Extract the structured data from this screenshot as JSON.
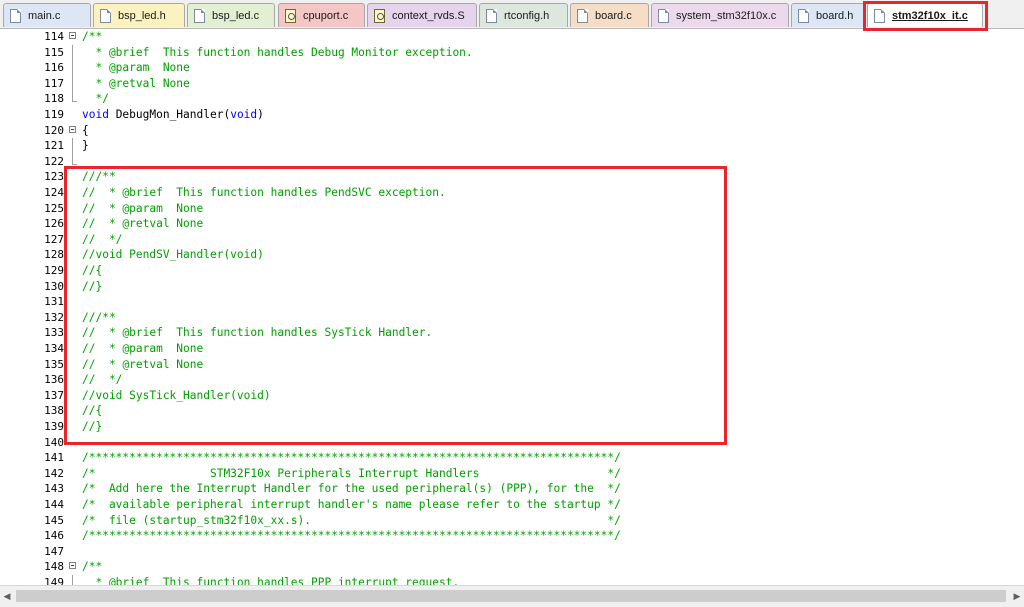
{
  "tabs": [
    {
      "label": "main.c",
      "color": "#dce6f4",
      "icon": "c-file-icon",
      "active": false
    },
    {
      "label": "bsp_led.h",
      "color": "#fbf2bf",
      "icon": "h-file-icon",
      "active": false
    },
    {
      "label": "bsp_led.c",
      "color": "#e3efd3",
      "icon": "c-file-icon",
      "active": false
    },
    {
      "label": "cpuport.c",
      "color": "#f4c6c6",
      "icon": "c-file-icon-special",
      "active": false
    },
    {
      "label": "context_rvds.S",
      "color": "#e6d4ec",
      "icon": "asm-file-icon-special",
      "active": false
    },
    {
      "label": "rtconfig.h",
      "color": "#dde7dd",
      "icon": "h-file-icon",
      "active": false
    },
    {
      "label": "board.c",
      "color": "#f5ddc8",
      "icon": "c-file-icon",
      "active": false
    },
    {
      "label": "system_stm32f10x.c",
      "color": "#ecdaec",
      "icon": "c-file-icon",
      "active": false
    },
    {
      "label": "board.h",
      "color": "#dce6f4",
      "icon": "h-file-icon",
      "active": false
    },
    {
      "label": "stm32f10x_it.c",
      "color": "#ffffff",
      "icon": "c-file-icon",
      "active": true
    }
  ],
  "highlight_color": "#e8262c",
  "editor": {
    "lines": [
      {
        "num": "114",
        "fold": "box",
        "style": "comment",
        "tokens": [
          {
            "t": "/**",
            "c": "cm"
          }
        ]
      },
      {
        "num": "115",
        "fold": "line",
        "style": "comment",
        "tokens": [
          {
            "t": "  * @brief  This function handles Debug Monitor exception.",
            "c": "cm"
          }
        ]
      },
      {
        "num": "116",
        "fold": "line",
        "style": "comment",
        "tokens": [
          {
            "t": "  * @param  None",
            "c": "cm"
          }
        ]
      },
      {
        "num": "117",
        "fold": "line",
        "style": "comment",
        "tokens": [
          {
            "t": "  * @retval None",
            "c": "cm"
          }
        ]
      },
      {
        "num": "118",
        "fold": "end",
        "style": "comment",
        "tokens": [
          {
            "t": "  */",
            "c": "cm"
          }
        ]
      },
      {
        "num": "119",
        "fold": "",
        "style": "code",
        "tokens": [
          {
            "t": "void",
            "c": "kw"
          },
          {
            "t": " DebugMon_Handler(",
            "c": "pl"
          },
          {
            "t": "void",
            "c": "kw"
          },
          {
            "t": ")",
            "c": "pl"
          }
        ]
      },
      {
        "num": "120",
        "fold": "box",
        "style": "code",
        "tokens": [
          {
            "t": "{",
            "c": "pl"
          }
        ]
      },
      {
        "num": "121",
        "fold": "line",
        "style": "code",
        "tokens": [
          {
            "t": "}",
            "c": "pl"
          }
        ]
      },
      {
        "num": "122",
        "fold": "end",
        "style": "code",
        "tokens": []
      },
      {
        "num": "123",
        "fold": "",
        "style": "comment",
        "tokens": [
          {
            "t": "///**",
            "c": "cm"
          }
        ]
      },
      {
        "num": "124",
        "fold": "",
        "style": "comment",
        "tokens": [
          {
            "t": "//  * @brief  This function handles PendSVC exception.",
            "c": "cm"
          }
        ]
      },
      {
        "num": "125",
        "fold": "",
        "style": "comment",
        "tokens": [
          {
            "t": "//  * @param  None",
            "c": "cm"
          }
        ]
      },
      {
        "num": "126",
        "fold": "",
        "style": "comment",
        "tokens": [
          {
            "t": "//  * @retval None",
            "c": "cm"
          }
        ]
      },
      {
        "num": "127",
        "fold": "",
        "style": "comment",
        "tokens": [
          {
            "t": "//  */",
            "c": "cm"
          }
        ]
      },
      {
        "num": "128",
        "fold": "",
        "style": "comment",
        "tokens": [
          {
            "t": "//void PendSV_Handler(void)",
            "c": "cm"
          }
        ]
      },
      {
        "num": "129",
        "fold": "",
        "style": "comment",
        "tokens": [
          {
            "t": "//{",
            "c": "cm"
          }
        ]
      },
      {
        "num": "130",
        "fold": "",
        "style": "comment",
        "tokens": [
          {
            "t": "//}",
            "c": "cm"
          }
        ]
      },
      {
        "num": "131",
        "fold": "",
        "style": "comment",
        "tokens": []
      },
      {
        "num": "132",
        "fold": "",
        "style": "comment",
        "tokens": [
          {
            "t": "///**",
            "c": "cm"
          }
        ]
      },
      {
        "num": "133",
        "fold": "",
        "style": "comment",
        "tokens": [
          {
            "t": "//  * @brief  This function handles SysTick Handler.",
            "c": "cm"
          }
        ]
      },
      {
        "num": "134",
        "fold": "",
        "style": "comment",
        "tokens": [
          {
            "t": "//  * @param  None",
            "c": "cm"
          }
        ]
      },
      {
        "num": "135",
        "fold": "",
        "style": "comment",
        "tokens": [
          {
            "t": "//  * @retval None",
            "c": "cm"
          }
        ]
      },
      {
        "num": "136",
        "fold": "",
        "style": "comment",
        "tokens": [
          {
            "t": "//  */",
            "c": "cm"
          }
        ]
      },
      {
        "num": "137",
        "fold": "",
        "style": "comment",
        "tokens": [
          {
            "t": "//void SysTick_Handler(void)",
            "c": "cm"
          }
        ]
      },
      {
        "num": "138",
        "fold": "",
        "style": "comment",
        "tokens": [
          {
            "t": "//{",
            "c": "cm"
          }
        ]
      },
      {
        "num": "139",
        "fold": "",
        "style": "comment",
        "tokens": [
          {
            "t": "//}",
            "c": "cm"
          }
        ]
      },
      {
        "num": "140",
        "fold": "",
        "style": "comment",
        "tokens": []
      },
      {
        "num": "141",
        "fold": "",
        "style": "comment",
        "tokens": [
          {
            "t": "/******************************************************************************/",
            "c": "cm"
          }
        ]
      },
      {
        "num": "142",
        "fold": "",
        "style": "comment",
        "tokens": [
          {
            "t": "/*                 STM32F10x Peripherals Interrupt Handlers                   */",
            "c": "cm"
          }
        ]
      },
      {
        "num": "143",
        "fold": "",
        "style": "comment",
        "tokens": [
          {
            "t": "/*  Add here the Interrupt Handler for the used peripheral(s) (PPP), for the  */",
            "c": "cm"
          }
        ]
      },
      {
        "num": "144",
        "fold": "",
        "style": "comment",
        "tokens": [
          {
            "t": "/*  available peripheral interrupt handler's name please refer to the startup */",
            "c": "cm"
          }
        ]
      },
      {
        "num": "145",
        "fold": "",
        "style": "comment",
        "tokens": [
          {
            "t": "/*  file (startup_stm32f10x_xx.s).                                            */",
            "c": "cm"
          }
        ]
      },
      {
        "num": "146",
        "fold": "",
        "style": "comment",
        "tokens": [
          {
            "t": "/******************************************************************************/",
            "c": "cm"
          }
        ]
      },
      {
        "num": "147",
        "fold": "",
        "style": "comment",
        "tokens": []
      },
      {
        "num": "148",
        "fold": "box",
        "style": "comment",
        "tokens": [
          {
            "t": "/**",
            "c": "cm"
          }
        ]
      },
      {
        "num": "149",
        "fold": "line",
        "style": "comment",
        "tokens": [
          {
            "t": "  * @brief  This function handles PPP interrupt request.",
            "c": "cm"
          }
        ]
      }
    ]
  }
}
